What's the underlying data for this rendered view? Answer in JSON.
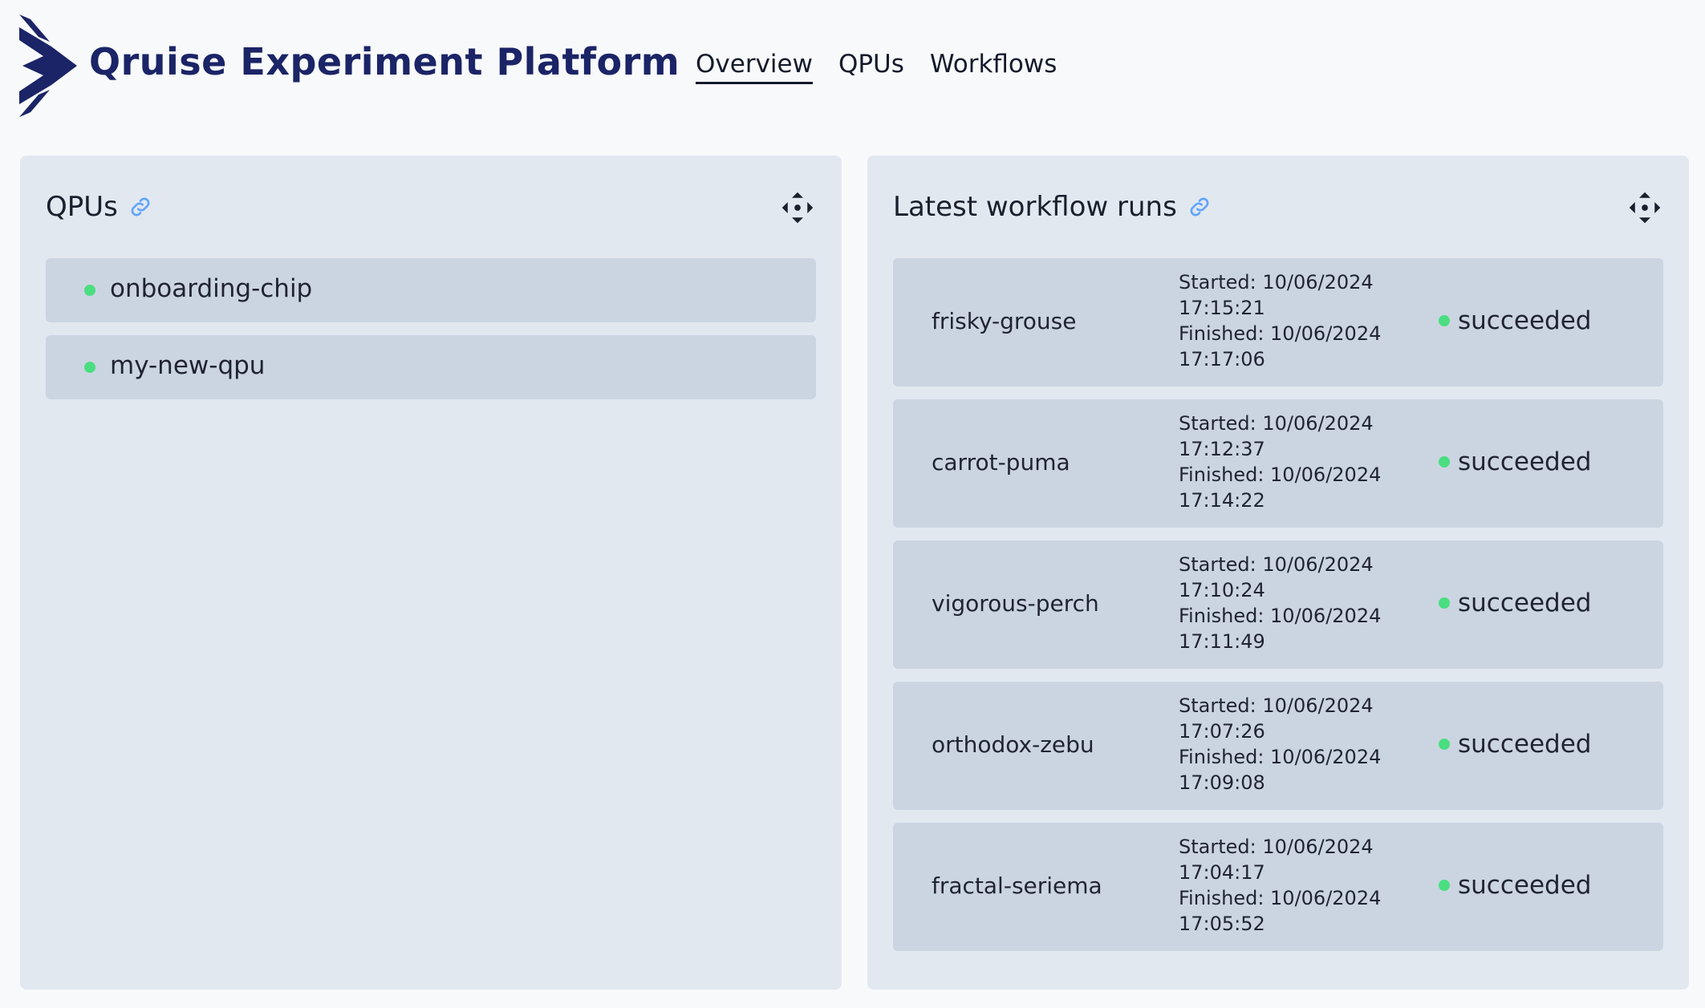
{
  "header": {
    "brand": "Qruise Experiment Platform",
    "nav": [
      {
        "label": "Overview",
        "active": true
      },
      {
        "label": "QPUs",
        "active": false
      },
      {
        "label": "Workflows",
        "active": false
      }
    ]
  },
  "qpus_panel": {
    "title": "QPUs",
    "link_icon": "link-icon",
    "move_icon": "move-icon",
    "items": [
      {
        "name": "onboarding-chip",
        "status_color": "#4ade80"
      },
      {
        "name": "my-new-qpu",
        "status_color": "#4ade80"
      }
    ]
  },
  "runs_panel": {
    "title": "Latest workflow runs",
    "link_icon": "link-icon",
    "move_icon": "move-icon",
    "runs": [
      {
        "name": "frisky-grouse",
        "started_label": "Started: 10/06/2024",
        "started_time": "17:15:21",
        "finished_label": "Finished: 10/06/2024",
        "finished_time": "17:17:06",
        "status": "succeeded"
      },
      {
        "name": "carrot-puma",
        "started_label": "Started: 10/06/2024",
        "started_time": "17:12:37",
        "finished_label": "Finished: 10/06/2024",
        "finished_time": "17:14:22",
        "status": "succeeded"
      },
      {
        "name": "vigorous-perch",
        "started_label": "Started: 10/06/2024",
        "started_time": "17:10:24",
        "finished_label": "Finished: 10/06/2024",
        "finished_time": "17:11:49",
        "status": "succeeded"
      },
      {
        "name": "orthodox-zebu",
        "started_label": "Started: 10/06/2024",
        "started_time": "17:07:26",
        "finished_label": "Finished: 10/06/2024",
        "finished_time": "17:09:08",
        "status": "succeeded"
      },
      {
        "name": "fractal-seriema",
        "started_label": "Started: 10/06/2024",
        "started_time": "17:04:17",
        "finished_label": "Finished: 10/06/2024",
        "finished_time": "17:05:52",
        "status": "succeeded"
      }
    ]
  },
  "colors": {
    "brand": "#1b2466",
    "panel_bg": "#e2e8f0",
    "item_bg": "#cbd5e1",
    "status_success": "#4ade80",
    "link_accent": "#60a5fa"
  }
}
